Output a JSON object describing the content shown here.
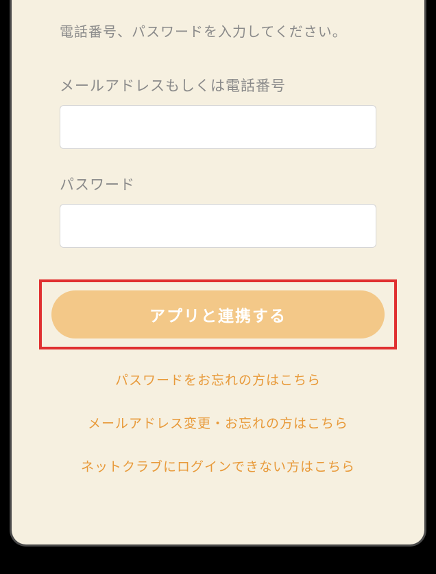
{
  "instruction": "電話番号、パスワードを入力してください。",
  "fields": {
    "email_phone": {
      "label": "メールアドレスもしくは電話番号",
      "value": ""
    },
    "password": {
      "label": "パスワード",
      "value": ""
    }
  },
  "submit_label": "アプリと連携する",
  "links": {
    "forgot_password": "パスワードをお忘れの方はこちら",
    "change_email": "メールアドレス変更・お忘れの方はこちら",
    "cannot_login": "ネットクラブにログインできない方はこちら"
  }
}
